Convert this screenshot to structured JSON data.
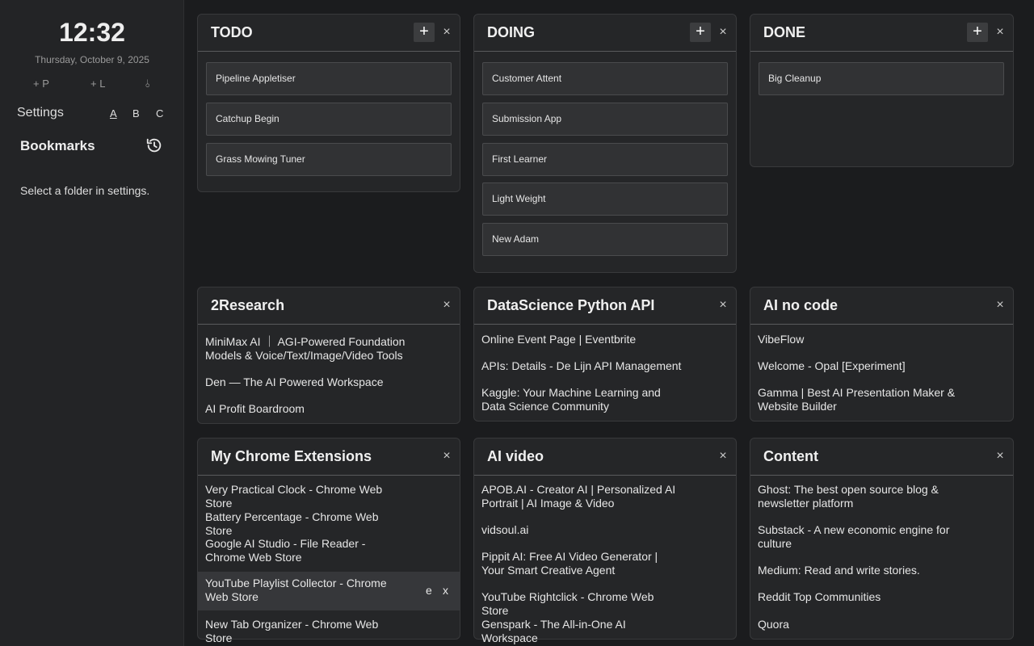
{
  "sidebar": {
    "time": "12:32",
    "date": "Thursday, October 9, 2025",
    "quick_actions": [
      "+ P",
      "+ L",
      "⫰"
    ],
    "settings_label": "Settings",
    "theme_options": [
      "A",
      "B",
      "C"
    ],
    "bookmarks_title": "Bookmarks",
    "bookmarks_message": "Select a folder in settings."
  },
  "kanban": {
    "add_label": "+",
    "close_label": "×",
    "columns": [
      {
        "title": "TODO",
        "tasks": [
          "Pipeline Appletiser",
          "Catchup Begin",
          "Grass Mowing Tuner"
        ]
      },
      {
        "title": "DOING",
        "tasks": [
          "Customer Attent",
          "Submission App",
          "First Learner",
          "Light Weight",
          "New Adam"
        ]
      },
      {
        "title": "DONE",
        "tasks": [
          "Big Cleanup"
        ]
      }
    ]
  },
  "bookmark_groups": {
    "close_label": "×",
    "edit_label": "e",
    "remove_label": "x",
    "groups": [
      {
        "title": "2Research",
        "links": [
          "MiniMax AI ｜ AGI-Powered Foundation Models & Voice/Text/Image/Video Tools",
          "Den — The AI Powered Workspace",
          "AI Profit Boardroom"
        ]
      },
      {
        "title": "DataScience Python API",
        "links": [
          "Online Event Page | Eventbrite",
          "APIs: Details - De Lijn API Management",
          "Kaggle: Your Machine Learning and Data Science Community"
        ]
      },
      {
        "title": "AI no code",
        "links": [
          "VibeFlow",
          "Welcome - Opal [Experiment]",
          "Gamma | Best AI Presentation Maker & Website Builder"
        ]
      },
      {
        "title": "My Chrome Extensions",
        "links": [
          "Very Practical Clock - Chrome Web Store",
          "Battery Percentage - Chrome Web Store",
          "Google AI Studio - File Reader - Chrome Web Store",
          "YouTube Playlist Collector - Chrome Web Store",
          "New Tab Organizer - Chrome Web Store"
        ]
      },
      {
        "title": "AI video",
        "links": [
          "APOB.AI - Creator AI | Personalized AI Portrait | AI Image & Video",
          "vidsoul.ai",
          "Pippit AI: Free AI Video Generator | Your Smart Creative Agent",
          "YouTube Rightclick - Chrome Web Store",
          "Genspark - The All-in-One AI Workspace"
        ]
      },
      {
        "title": "Content",
        "links": [
          "Ghost: The best open source blog & newsletter platform",
          "Substack - A new economic engine for culture",
          "Medium: Read and write stories.",
          "Reddit Top Communities",
          "Quora"
        ]
      }
    ]
  }
}
